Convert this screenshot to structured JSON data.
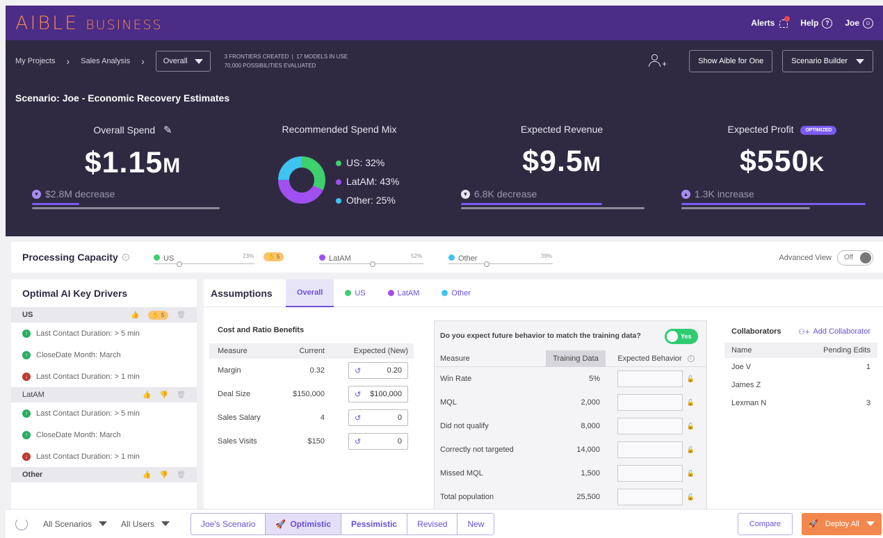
{
  "brand": {
    "logo_main": "AIBLE",
    "logo_sub": "BUSINESS",
    "accent": "#f28a4c",
    "header_bg": "#4b2c86"
  },
  "topbar": {
    "alerts": "Alerts",
    "help": "Help",
    "user": "Joe"
  },
  "nav": {
    "crumbs": [
      "My Projects",
      "Sales Analysis"
    ],
    "view_select": "Overall",
    "stats_line1": "3 FRONTIERS CREATED  |  17 MODELS IN USE",
    "stats_line2": "70,000 POSSIBILITIES EVALUATED",
    "show_aible": "Show Aible for One",
    "scenario_builder": "Scenario Builder"
  },
  "hero": {
    "title": "Scenario: Joe - Economic Recovery Estimates",
    "spend": {
      "label": "Overall Spend",
      "value": "$1.15",
      "suffix": "M",
      "delta": "$2.8M decrease",
      "progress": 0.25
    },
    "mix": {
      "label": "Recommended Spend Mix",
      "items": [
        {
          "label": "US: 32%",
          "pct": 32,
          "color": "#3ecf6e"
        },
        {
          "label": "LatAM: 43%",
          "pct": 43,
          "color": "#a04ff0"
        },
        {
          "label": "Other: 25%",
          "pct": 25,
          "color": "#3fc3f0"
        }
      ]
    },
    "revenue": {
      "label": "Expected Revenue",
      "value": "$9.5",
      "suffix": "M",
      "delta": "6.8K decrease",
      "progress": 0.77
    },
    "profit": {
      "label": "Expected Profit",
      "badge": "OPTIMIZED",
      "value": "$550",
      "suffix": "K",
      "delta": "1.3K increase",
      "progress": 1.0
    }
  },
  "capacity": {
    "title": "Processing Capacity",
    "regions": [
      {
        "name": "US",
        "pct": "23%",
        "pill": "5",
        "color": "#3ecf6e"
      },
      {
        "name": "LatAM",
        "pct": "52%",
        "color": "#a04ff0"
      },
      {
        "name": "Other",
        "pct": "39%",
        "color": "#3fc3f0"
      }
    ],
    "advanced_label": "Advanced View",
    "toggle": "Off"
  },
  "drivers": {
    "title": "Optimal AI Key Drivers",
    "groups": [
      {
        "name": "US",
        "pill": "5",
        "items": [
          {
            "dir": "up",
            "text": "Last Contact Duration: > 5 min"
          },
          {
            "dir": "up",
            "text": "CloseDate Month:  March"
          },
          {
            "dir": "down",
            "text": "Last Contact Duration: > 1 min"
          }
        ]
      },
      {
        "name": "LatAM",
        "items": [
          {
            "dir": "up",
            "text": "Last Contact Duration: > 5 min"
          },
          {
            "dir": "up",
            "text": "CloseDate Month:  March"
          },
          {
            "dir": "down",
            "text": "Last Contact Duration: > 1 min"
          }
        ]
      },
      {
        "name": "Other",
        "items": []
      }
    ]
  },
  "assumptions": {
    "title": "Assumptions",
    "tabs": [
      "Overall",
      "US",
      "LatAM",
      "Other"
    ],
    "cost_title": "Cost and Ratio Benefits",
    "cost_headers": [
      "Measure",
      "Current",
      "Expected (New)"
    ],
    "cost_rows": [
      {
        "measure": "Margin",
        "current": "0.32",
        "expected": "0.20"
      },
      {
        "measure": "Deal Size",
        "current": "$150,000",
        "expected": "$100,000"
      },
      {
        "measure": "Sales Salary",
        "current": "4",
        "expected": "0"
      },
      {
        "measure": "Sales Visits",
        "current": "$150",
        "expected": "0"
      }
    ],
    "question": "Do you expect future behavior to match the training data?",
    "question_toggle": "Yes",
    "behav_headers": [
      "Measure",
      "Training Data",
      "Expected Behavior"
    ],
    "behav_rows": [
      {
        "measure": "Win Rate",
        "training": "5%"
      },
      {
        "measure": "MQL",
        "training": "2,000"
      },
      {
        "measure": "Did not qualify",
        "training": "8,000"
      },
      {
        "measure": "Correctly not targeted",
        "training": "14,000"
      },
      {
        "measure": "Missed MQL",
        "training": "1,500"
      },
      {
        "measure": "Total population",
        "training": "25,500"
      }
    ],
    "collab_title": "Collaborators",
    "collab_add": "Add Collaborator",
    "collab_headers": [
      "Name",
      "Pending Edits"
    ],
    "collaborators": [
      {
        "name": "Joe V",
        "edits": "1"
      },
      {
        "name": "James Z",
        "edits": ""
      },
      {
        "name": "Lexman N",
        "edits": "3"
      }
    ]
  },
  "bottom": {
    "all_scenarios": "All Scenarios",
    "all_users": "All Users",
    "scenario_tabs": [
      "Joe's Scenario",
      "Optimistic",
      "Pessimistic",
      "Revised",
      "New"
    ],
    "compare": "Compare",
    "deploy": "Deploy All"
  }
}
